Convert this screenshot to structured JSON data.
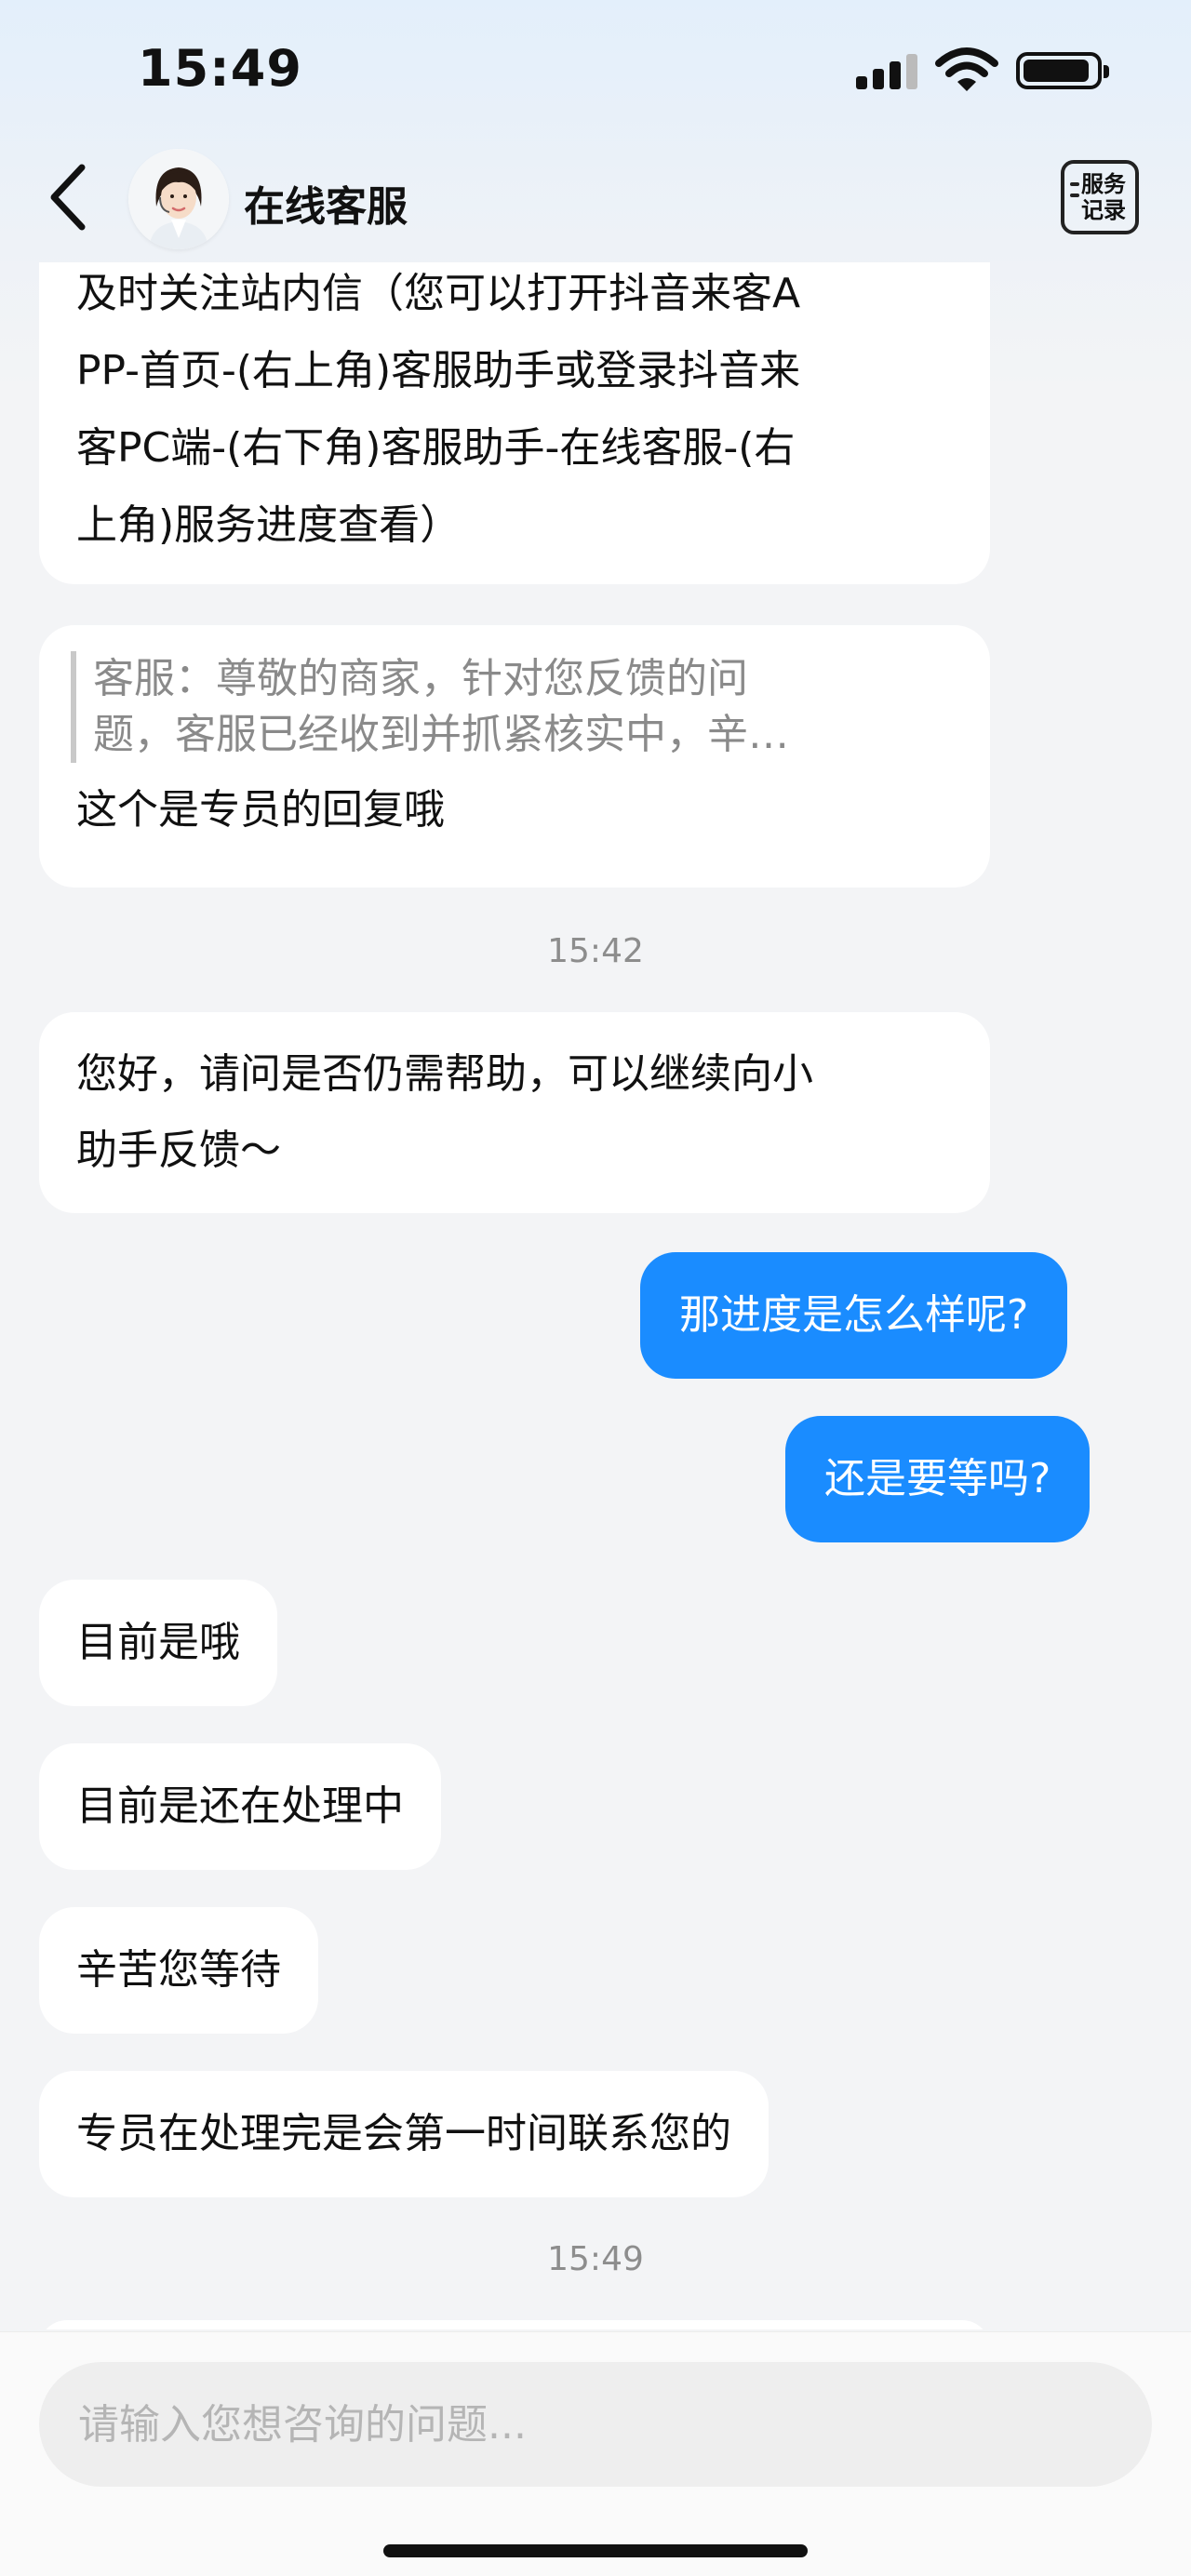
{
  "status_bar": {
    "time": "15:49"
  },
  "header": {
    "title": "在线客服",
    "service_record": [
      "服务",
      "记录"
    ]
  },
  "messages": {
    "m1": [
      "及时关注站内信（您可以打开抖音来客A",
      "PP-首页-(右上角)客服助手或登录抖音来",
      "客PC端-(右下角)客服助手-在线客服-(右",
      "上角)服务进度查看）"
    ],
    "m2_quote": [
      "客服：尊敬的商家，针对您反馈的问",
      "题，客服已经收到并抓紧核实中，辛…"
    ],
    "m2_text": "这个是专员的回复哦",
    "time1": "15:42",
    "m3": [
      "您好，请问是否仍需帮助，可以继续向小",
      "助手反馈～"
    ],
    "m4": "那进度是怎么样呢?",
    "m5": "还是要等吗?",
    "m6": "目前是哦",
    "m7": "目前是还在处理中",
    "m8": "辛苦您等待",
    "m9": "专员在处理完是会第一时间联系您的",
    "time2": "15:49"
  },
  "input": {
    "placeholder": "请输入您想咨询的问题..."
  },
  "colors": {
    "accent": "#1a8cff",
    "bubble_bg": "#ffffff",
    "page_bg": "#f3f4f6"
  }
}
